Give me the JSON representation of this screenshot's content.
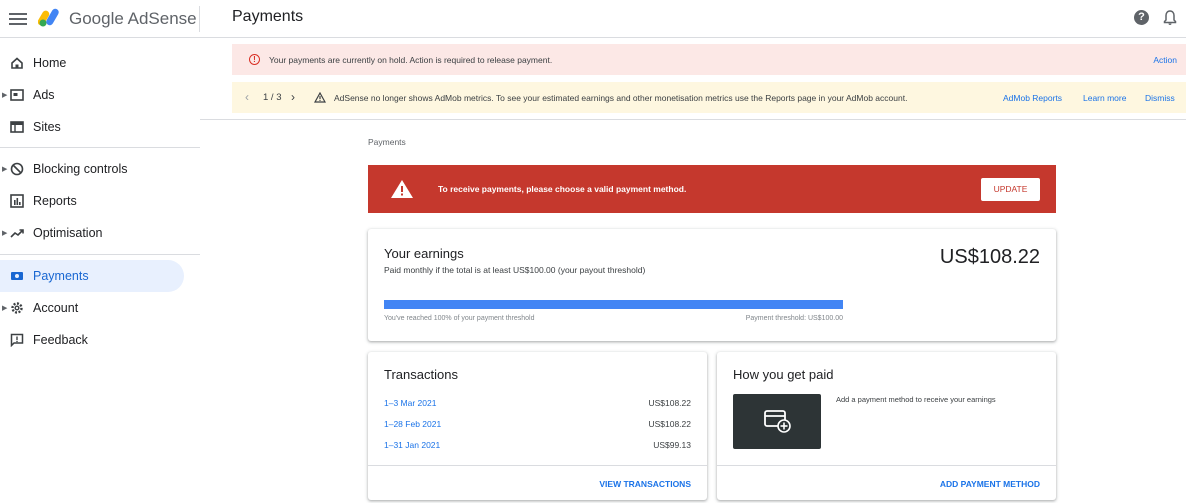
{
  "header": {
    "brand": "Google AdSense",
    "page_title": "Payments"
  },
  "sidebar": {
    "items": [
      {
        "label": "Home",
        "icon": "home-icon"
      },
      {
        "label": "Ads",
        "icon": "ads-icon"
      },
      {
        "label": "Sites",
        "icon": "sites-icon"
      },
      {
        "label": "Blocking controls",
        "icon": "block-icon"
      },
      {
        "label": "Reports",
        "icon": "reports-icon"
      },
      {
        "label": "Optimisation",
        "icon": "trending-icon"
      },
      {
        "label": "Payments",
        "icon": "payments-icon",
        "active": true
      },
      {
        "label": "Account",
        "icon": "gear-icon"
      },
      {
        "label": "Feedback",
        "icon": "feedback-icon"
      }
    ]
  },
  "alerts": {
    "hold": {
      "text": "Your payments are currently on hold. Action is required to release payment.",
      "action": "Action"
    },
    "admob": {
      "counter": "1 / 3",
      "text": "AdSense no longer shows AdMob metrics. To see your estimated earnings and other monetisation metrics use the Reports page in your AdMob account.",
      "link1": "AdMob Reports",
      "link2": "Learn more",
      "link3": "Dismiss"
    }
  },
  "breadcrumb": "Payments",
  "error_banner": {
    "text": "To receive payments, please choose a valid payment method.",
    "button": "UPDATE"
  },
  "earnings": {
    "title": "Your earnings",
    "subtitle": "Paid monthly if the total is at least US$100.00 (your payout threshold)",
    "amount": "US$108.22",
    "progress_percent": 100,
    "progress_left": "You've reached 100% of your payment threshold",
    "progress_right": "Payment threshold: US$100.00"
  },
  "transactions": {
    "title": "Transactions",
    "rows": [
      {
        "date": "1–3 Mar 2021",
        "amount": "US$108.22"
      },
      {
        "date": "1–28 Feb 2021",
        "amount": "US$108.22"
      },
      {
        "date": "1–31 Jan 2021",
        "amount": "US$99.13"
      }
    ],
    "button": "VIEW TRANSACTIONS"
  },
  "how_paid": {
    "title": "How you get paid",
    "description": "Add a payment method to receive your earnings",
    "button": "ADD PAYMENT METHOD"
  },
  "colors": {
    "accent": "#1a73e8",
    "error": "#c5382d",
    "progress": "#4285f4",
    "active_nav_bg": "#e8f0fe"
  }
}
